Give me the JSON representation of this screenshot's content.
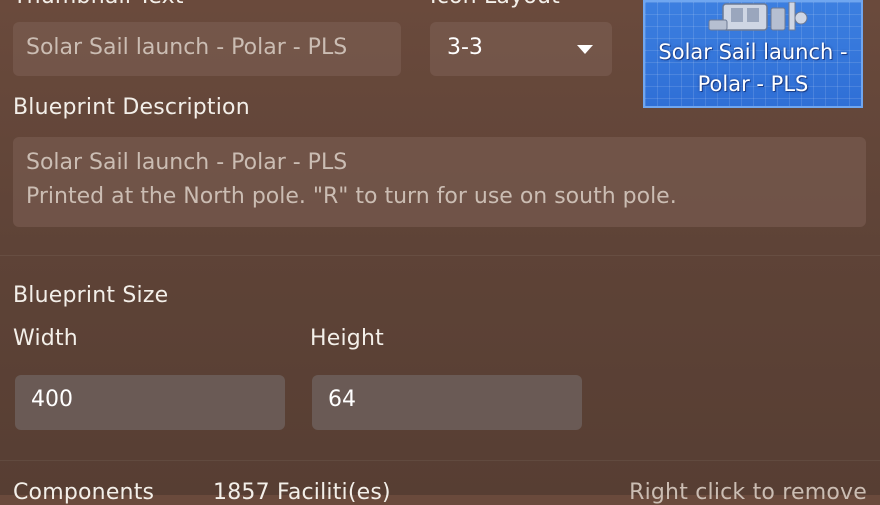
{
  "thumbnail_text": {
    "label": "Thumbnail Text",
    "value": "Solar Sail launch - Polar  - PLS"
  },
  "icon_layout": {
    "label": "Icon Layout",
    "value": "3-3"
  },
  "thumbnail_preview": {
    "text": "Solar Sail launch - Polar  - PLS",
    "accent_color": "#3478e0"
  },
  "blueprint_description": {
    "label": "Blueprint  Description",
    "line1": "Solar Sail launch - Polar  - PLS",
    "line2": "Printed at the North pole. \"R\" to turn for use on south pole."
  },
  "blueprint_size": {
    "label": "Blueprint Size",
    "width_label": "Width",
    "width_value": "400",
    "height_label": "Height",
    "height_value": "64"
  },
  "components": {
    "label": "Components",
    "value": "1857 Faciliti(es)",
    "hint": "Right click to remove"
  }
}
